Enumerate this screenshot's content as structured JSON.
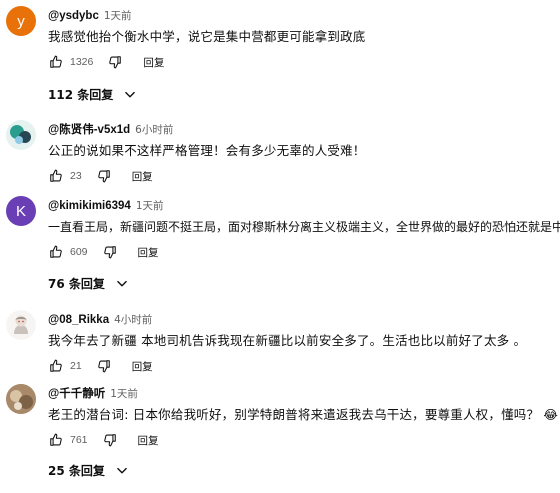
{
  "reply_label": "回复",
  "comments": [
    {
      "avatar_letter": "Y",
      "avatar_color": "#e8710a",
      "author": "@ysdybc",
      "time": "1天前",
      "text": "我感觉他抬个衡水中学，说它是集中营都更可能拿到政底",
      "likes": "1326",
      "replies_count": "112 条回复"
    },
    {
      "avatar_letter": "",
      "avatar_color": "#2a9d8f",
      "author": "@陈贤伟-v5x1d",
      "time": "6小时前",
      "text": "公正的说如果不这样严格管理！会有多少无辜的人受难！",
      "likes": "23"
    },
    {
      "avatar_letter": "K",
      "avatar_color": "#6a3fb5",
      "author": "@kimikimi6394",
      "time": "1天前",
      "text": "一直看王局，新疆问题不挺王局，面对穆斯林分离主义极端主义，全世界做的最好的恐怕还就是中共",
      "likes": "609",
      "replies_count": "76 条回复"
    },
    {
      "avatar_letter": "",
      "avatar_color": "#e9e6e2",
      "author": "@08_Rikka",
      "time": "4小时前",
      "text": "我今年去了新疆 本地司机告诉我现在新疆比以前安全多了。生活也比以前好了太多 。",
      "likes": "21"
    },
    {
      "avatar_letter": "",
      "avatar_color": "#b89a7a",
      "author": "@千千静听",
      "time": "1天前",
      "text": "老王的潜台词: 日本你给我听好，别学特朗普将来遣返我去乌干达，要尊重人权，懂吗？ 😂",
      "likes": "761",
      "replies_count": "25 条回复"
    }
  ]
}
